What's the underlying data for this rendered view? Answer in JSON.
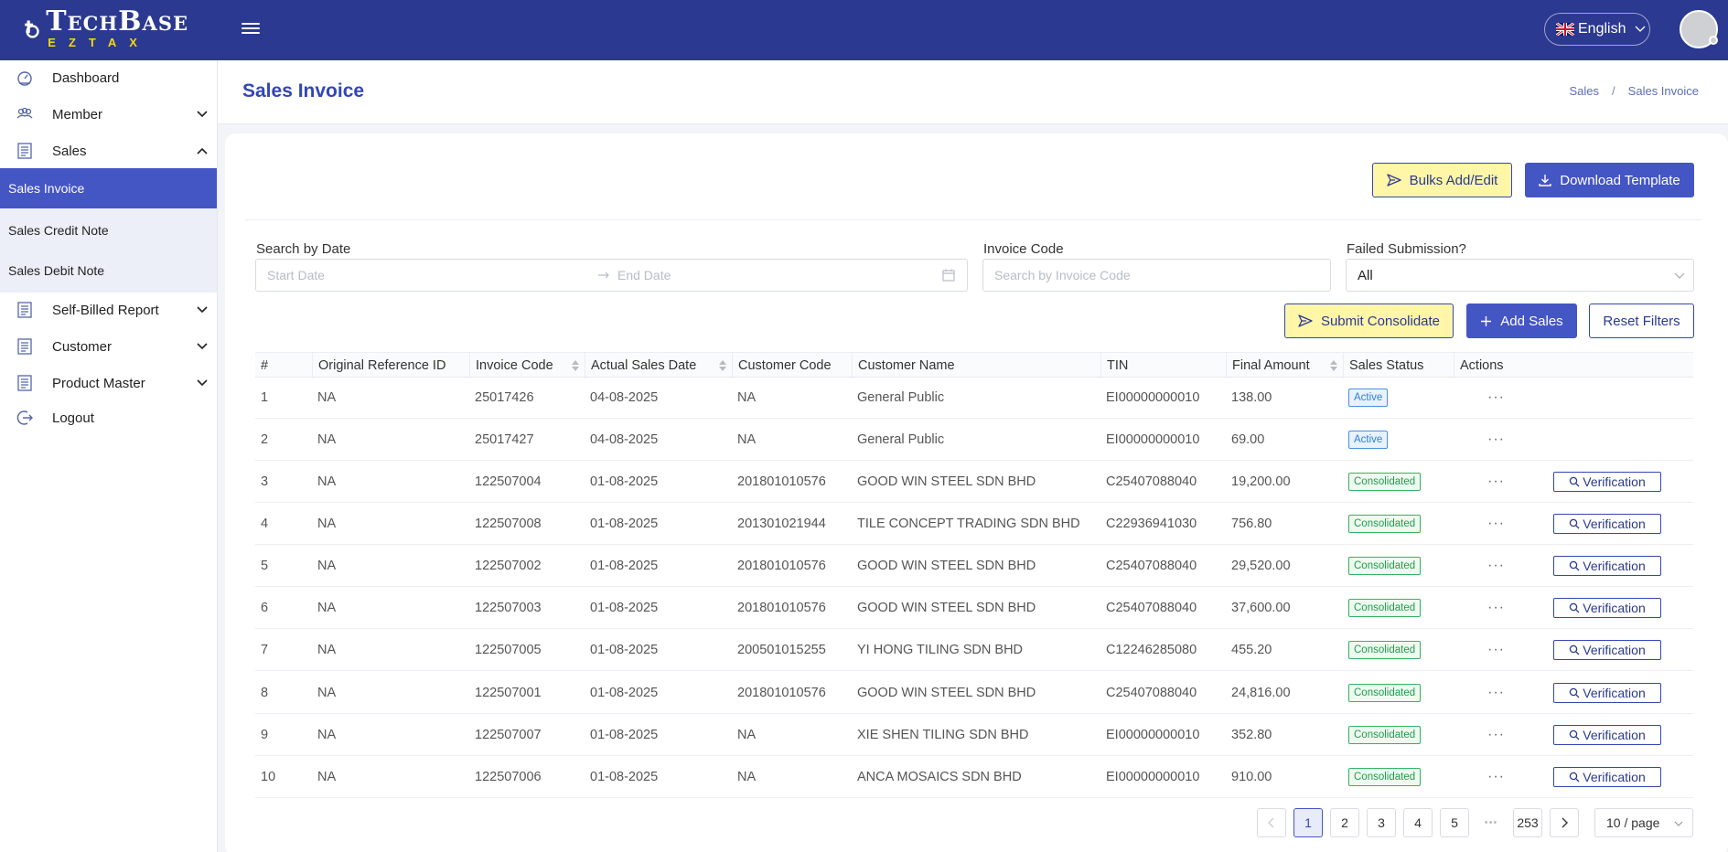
{
  "brand": {
    "name": "TechBase",
    "sub": "EZTAX"
  },
  "header": {
    "language": "English"
  },
  "sidebar": {
    "items": [
      {
        "label": "Dashboard"
      },
      {
        "label": "Member"
      },
      {
        "label": "Sales"
      },
      {
        "label": "Self-Billed Report"
      },
      {
        "label": "Customer"
      },
      {
        "label": "Product Master"
      },
      {
        "label": "Logout"
      }
    ],
    "sales_submenu": [
      {
        "label": "Sales Invoice"
      },
      {
        "label": "Sales Credit Note"
      },
      {
        "label": "Sales Debit Note"
      }
    ]
  },
  "page": {
    "title": "Sales Invoice",
    "breadcrumb": [
      "Sales",
      "Sales Invoice"
    ]
  },
  "actions": {
    "bulks": "Bulks Add/Edit",
    "download": "Download Template",
    "submit_consolidate": "Submit Consolidate",
    "add_sales": "Add Sales",
    "reset": "Reset Filters"
  },
  "filters": {
    "date_label": "Search by Date",
    "start_placeholder": "Start Date",
    "end_placeholder": "End Date",
    "invoice_label": "Invoice Code",
    "invoice_placeholder": "Search by Invoice Code",
    "failed_label": "Failed Submission?",
    "failed_value": "All"
  },
  "table": {
    "columns": [
      "#",
      "Original Reference ID",
      "Invoice Code",
      "Actual Sales Date",
      "Customer Code",
      "Customer Name",
      "TIN",
      "Final Amount",
      "Sales Status",
      "Actions"
    ],
    "verify_label": "Verification",
    "rows": [
      {
        "no": "1",
        "ref": "NA",
        "invoice": "25017426",
        "date": "04-08-2025",
        "cust_code": "NA",
        "cust_name": "General Public",
        "tin": "EI00000000010",
        "amount": "138.00",
        "status": "Active"
      },
      {
        "no": "2",
        "ref": "NA",
        "invoice": "25017427",
        "date": "04-08-2025",
        "cust_code": "NA",
        "cust_name": "General Public",
        "tin": "EI00000000010",
        "amount": "69.00",
        "status": "Active"
      },
      {
        "no": "3",
        "ref": "NA",
        "invoice": "122507004",
        "date": "01-08-2025",
        "cust_code": "201801010576",
        "cust_name": "GOOD WIN STEEL SDN BHD",
        "tin": "C25407088040",
        "amount": "19,200.00",
        "status": "Consolidated"
      },
      {
        "no": "4",
        "ref": "NA",
        "invoice": "122507008",
        "date": "01-08-2025",
        "cust_code": "201301021944",
        "cust_name": "TILE CONCEPT TRADING SDN BHD",
        "tin": "C22936941030",
        "amount": "756.80",
        "status": "Consolidated"
      },
      {
        "no": "5",
        "ref": "NA",
        "invoice": "122507002",
        "date": "01-08-2025",
        "cust_code": "201801010576",
        "cust_name": "GOOD WIN STEEL SDN BHD",
        "tin": "C25407088040",
        "amount": "29,520.00",
        "status": "Consolidated"
      },
      {
        "no": "6",
        "ref": "NA",
        "invoice": "122507003",
        "date": "01-08-2025",
        "cust_code": "201801010576",
        "cust_name": "GOOD WIN STEEL SDN BHD",
        "tin": "C25407088040",
        "amount": "37,600.00",
        "status": "Consolidated"
      },
      {
        "no": "7",
        "ref": "NA",
        "invoice": "122507005",
        "date": "01-08-2025",
        "cust_code": "200501015255",
        "cust_name": "YI HONG TILING SDN BHD",
        "tin": "C12246285080",
        "amount": "455.20",
        "status": "Consolidated"
      },
      {
        "no": "8",
        "ref": "NA",
        "invoice": "122507001",
        "date": "01-08-2025",
        "cust_code": "201801010576",
        "cust_name": "GOOD WIN STEEL SDN BHD",
        "tin": "C25407088040",
        "amount": "24,816.00",
        "status": "Consolidated"
      },
      {
        "no": "9",
        "ref": "NA",
        "invoice": "122507007",
        "date": "01-08-2025",
        "cust_code": "NA",
        "cust_name": "XIE SHEN TILING SDN BHD",
        "tin": "EI00000000010",
        "amount": "352.80",
        "status": "Consolidated"
      },
      {
        "no": "10",
        "ref": "NA",
        "invoice": "122507006",
        "date": "01-08-2025",
        "cust_code": "NA",
        "cust_name": "ANCA MOSAICS SDN BHD",
        "tin": "EI00000000010",
        "amount": "910.00",
        "status": "Consolidated"
      }
    ]
  },
  "pagination": {
    "pages": [
      "1",
      "2",
      "3",
      "4",
      "5"
    ],
    "ellipsis": "•••",
    "last": "253",
    "page_size": "10 / page",
    "current": "1"
  },
  "colors": {
    "primary": "#2b3990",
    "accent": "#4455c4",
    "highlight": "#fff6a8",
    "active_badge": "#2f7fd6",
    "consolidated_badge": "#1f9d4a"
  }
}
